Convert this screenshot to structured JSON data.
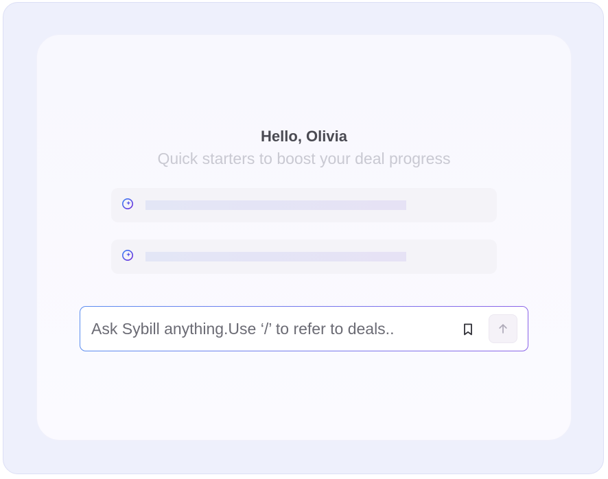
{
  "header": {
    "greeting": "Hello, Olivia",
    "subtitle": "Quick starters to boost your deal progress"
  },
  "starters": [
    {
      "icon": "crystal-ball-icon"
    },
    {
      "icon": "crystal-ball-icon"
    }
  ],
  "ask": {
    "placeholder": "Ask Sybill anything.Use ‘/’ to refer to deals..",
    "bookmark_icon": "bookmark-icon",
    "send_icon": "arrow-up-icon"
  },
  "colors": {
    "frame_background": "#eef0fc",
    "accent_blue": "#5a8cf0",
    "accent_purple": "#8a63e8",
    "icon_indigo": "#4f46e5"
  }
}
